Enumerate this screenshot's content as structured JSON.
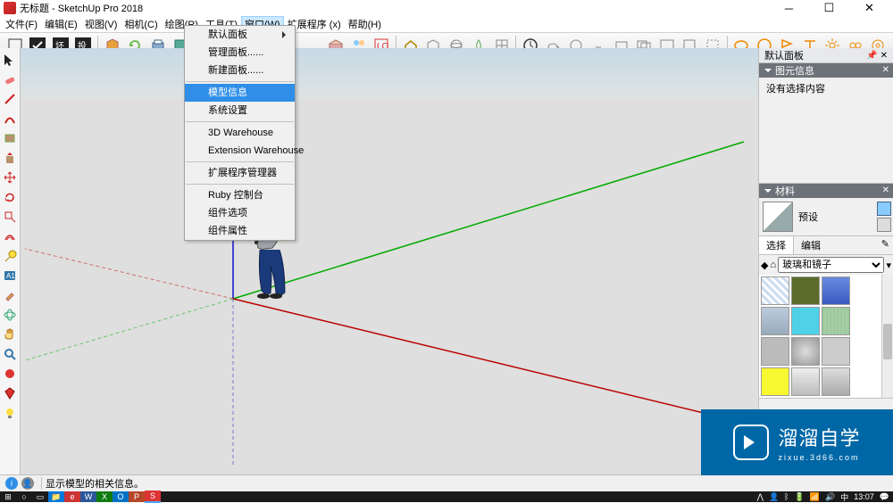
{
  "title": "无标题 - SketchUp Pro 2018",
  "menu": [
    "文件(F)",
    "编辑(E)",
    "视图(V)",
    "相机(C)",
    "绘图(R)",
    "工具(T)",
    "窗口(W)",
    "扩展程序 (x)",
    "帮助(H)"
  ],
  "menu_open_index": 6,
  "dropdown": {
    "items": [
      {
        "label": "默认面板",
        "submenu": true
      },
      {
        "label": "管理面板......"
      },
      {
        "label": "新建面板......"
      },
      {
        "sep": true
      },
      {
        "label": "模型信息",
        "hover": true
      },
      {
        "label": "系统设置"
      },
      {
        "sep": true
      },
      {
        "label": "3D Warehouse"
      },
      {
        "label": "Extension Warehouse"
      },
      {
        "sep": true
      },
      {
        "label": "扩展程序管理器"
      },
      {
        "sep": true
      },
      {
        "label": "Ruby 控制台"
      },
      {
        "label": "组件选项"
      },
      {
        "label": "组件属性"
      }
    ]
  },
  "panels": {
    "default_tray": "默认面板",
    "entity_info": {
      "title": "图元信息",
      "msg": "没有选择内容"
    },
    "materials": {
      "title": "材料",
      "preset": "预设",
      "select_tab": "选择",
      "edit_tab": "编辑",
      "category": "玻璃和镜子"
    }
  },
  "status_text": "显示模型的相关信息。",
  "watermark": {
    "brand": "溜溜自学",
    "url": "zixue.3d66.com"
  },
  "taskbar_time": "13:07",
  "colors": {
    "accent": "#2f8fe8"
  }
}
